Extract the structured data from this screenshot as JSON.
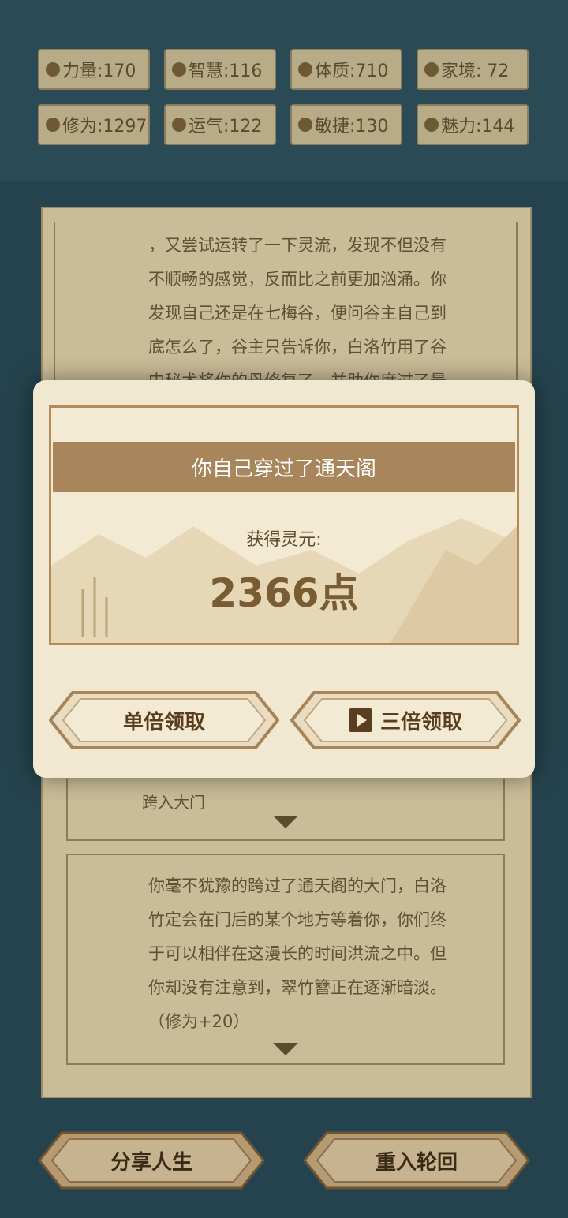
{
  "stats": [
    {
      "icon": "strength-icon",
      "label": "力量:170"
    },
    {
      "icon": "wisdom-icon",
      "label": "智慧:116"
    },
    {
      "icon": "constitution-icon",
      "label": "体质:710"
    },
    {
      "icon": "family-icon",
      "label": "家境: 72"
    },
    {
      "icon": "cultivation-icon",
      "label": "修为:1297"
    },
    {
      "icon": "luck-icon",
      "label": "运气:122"
    },
    {
      "icon": "agility-icon",
      "label": "敏捷:130"
    },
    {
      "icon": "charm-icon",
      "label": "魅力:144"
    }
  ],
  "story": {
    "para1": "，又尝试运转了一下灵流，发现不但没有不顺畅的感觉，反而比之前更加汹涌。你发现自己还是在七梅谷，便问谷主自己到底怎么了，谷主只告诉你，白洛竹用了谷中秘术将你的丹修复了，并助你度过了最",
    "para1_lines": [
      "，又尝试运转了一下灵流，发现不但没有",
      "不顺畅的感觉，反而比之前更加汹涌。你",
      "发现自己还是在七梅谷，便问谷主自己到",
      "底怎么了，谷主只告诉你，白洛竹用了谷",
      "中秘术将你的丹修复了，并助你度过了最"
    ],
    "choice": "跨入大门",
    "para2_lines": [
      "你毫不犹豫的跨过了通天阁的大门，白洛",
      "竹定会在门后的某个地方等着你，你们终",
      "于可以相伴在这漫长的时间洪流之中。但",
      "你却没有注意到，翠竹簪正在逐渐暗淡。",
      "（修为+20）"
    ]
  },
  "modal": {
    "title": "你自己穿过了通天阁",
    "reward_label": "获得灵元:",
    "reward_value": "2366点",
    "single_button": "单倍领取",
    "triple_button": "三倍领取"
  },
  "footer": {
    "share_button": "分享人生",
    "restart_button": "重入轮回"
  }
}
